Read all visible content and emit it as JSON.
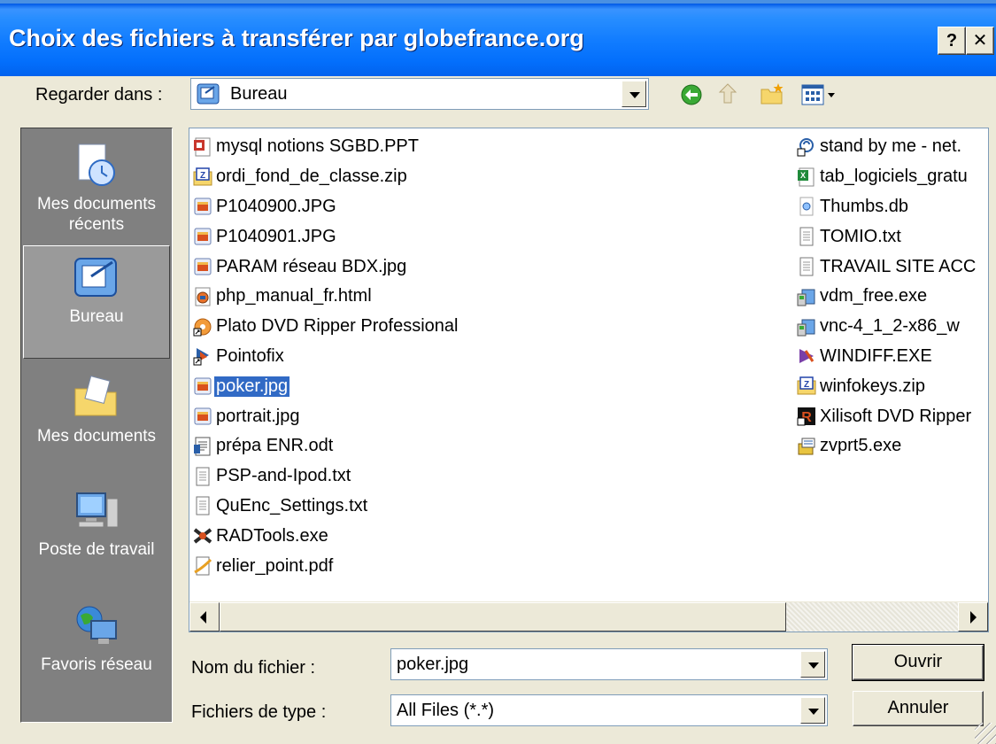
{
  "window": {
    "title": "Choix des fichiers à transférer par globefrance.org",
    "help_btn": "?",
    "close_btn": "✕"
  },
  "lookin": {
    "label": "Regarder dans :",
    "value": "Bureau"
  },
  "places": [
    {
      "label": "Mes documents récents",
      "icon": "recent-documents-icon"
    },
    {
      "label": "Bureau",
      "icon": "desktop-icon",
      "active": true
    },
    {
      "label": "Mes documents",
      "icon": "my-documents-icon"
    },
    {
      "label": "Poste de travail",
      "icon": "my-computer-icon"
    },
    {
      "label": "Favoris réseau",
      "icon": "network-places-icon"
    }
  ],
  "files": {
    "col1": [
      {
        "name": "mysql notions SGBD.PPT",
        "icon": "ppt"
      },
      {
        "name": "ordi_fond_de_classe.zip",
        "icon": "zip"
      },
      {
        "name": "P1040900.JPG",
        "icon": "jpg"
      },
      {
        "name": "P1040901.JPG",
        "icon": "jpg"
      },
      {
        "name": "PARAM réseau BDX.jpg",
        "icon": "jpg"
      },
      {
        "name": "php_manual_fr.html",
        "icon": "html"
      },
      {
        "name": "Plato DVD Ripper Professional",
        "icon": "shortcut-dvd"
      },
      {
        "name": "Pointofix",
        "icon": "shortcut-app"
      },
      {
        "name": "poker.jpg",
        "icon": "jpg",
        "selected": true
      },
      {
        "name": "portrait.jpg",
        "icon": "jpg"
      },
      {
        "name": "prépa ENR.odt",
        "icon": "odt"
      },
      {
        "name": "PSP-and-Ipod.txt",
        "icon": "txt"
      },
      {
        "name": "QuEnc_Settings.txt",
        "icon": "txt"
      },
      {
        "name": "RADTools.exe",
        "icon": "exe-rad"
      },
      {
        "name": "relier_point.pdf",
        "icon": "pdf"
      }
    ],
    "col2": [
      {
        "name": "stand by me - net.",
        "icon": "media"
      },
      {
        "name": "tab_logiciels_gratu",
        "icon": "xls"
      },
      {
        "name": "Thumbs.db",
        "icon": "db"
      },
      {
        "name": "TOMIO.txt",
        "icon": "txt"
      },
      {
        "name": "TRAVAIL SITE ACC",
        "icon": "txt"
      },
      {
        "name": "vdm_free.exe",
        "icon": "installer"
      },
      {
        "name": "vnc-4_1_2-x86_w",
        "icon": "installer"
      },
      {
        "name": "WINDIFF.EXE",
        "icon": "windiff"
      },
      {
        "name": "winfokeys.zip",
        "icon": "zip"
      },
      {
        "name": "Xilisoft DVD Ripper",
        "icon": "shortcut-xilisoft"
      },
      {
        "name": "zvprt5.exe",
        "icon": "exe"
      }
    ]
  },
  "filename": {
    "label": "Nom du fichier :",
    "value": "poker.jpg"
  },
  "filetype": {
    "label": "Fichiers de type :",
    "value": "All Files (*.*)"
  },
  "buttons": {
    "open": "Ouvrir",
    "cancel": "Annuler"
  }
}
